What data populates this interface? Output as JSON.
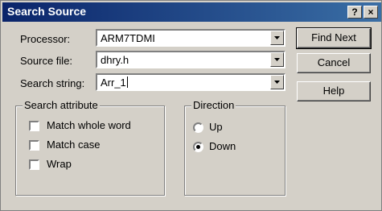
{
  "window": {
    "title": "Search Source",
    "help_label": "?",
    "close_label": "×"
  },
  "fields": {
    "processor": {
      "label": "Processor:",
      "value": "ARM7TDMI"
    },
    "source_file": {
      "label": "Source file:",
      "value": "dhry.h"
    },
    "search_string": {
      "label": "Search string:",
      "value": "Arr_1"
    }
  },
  "buttons": {
    "find_next": "Find Next",
    "cancel": "Cancel",
    "help": "Help"
  },
  "search_attribute": {
    "title": "Search attribute",
    "options": [
      {
        "label": "Match whole word",
        "checked": false
      },
      {
        "label": "Match case",
        "checked": false
      },
      {
        "label": "Wrap",
        "checked": false
      }
    ]
  },
  "direction": {
    "title": "Direction",
    "options": [
      {
        "label": "Up",
        "selected": false
      },
      {
        "label": "Down",
        "selected": true
      }
    ]
  }
}
